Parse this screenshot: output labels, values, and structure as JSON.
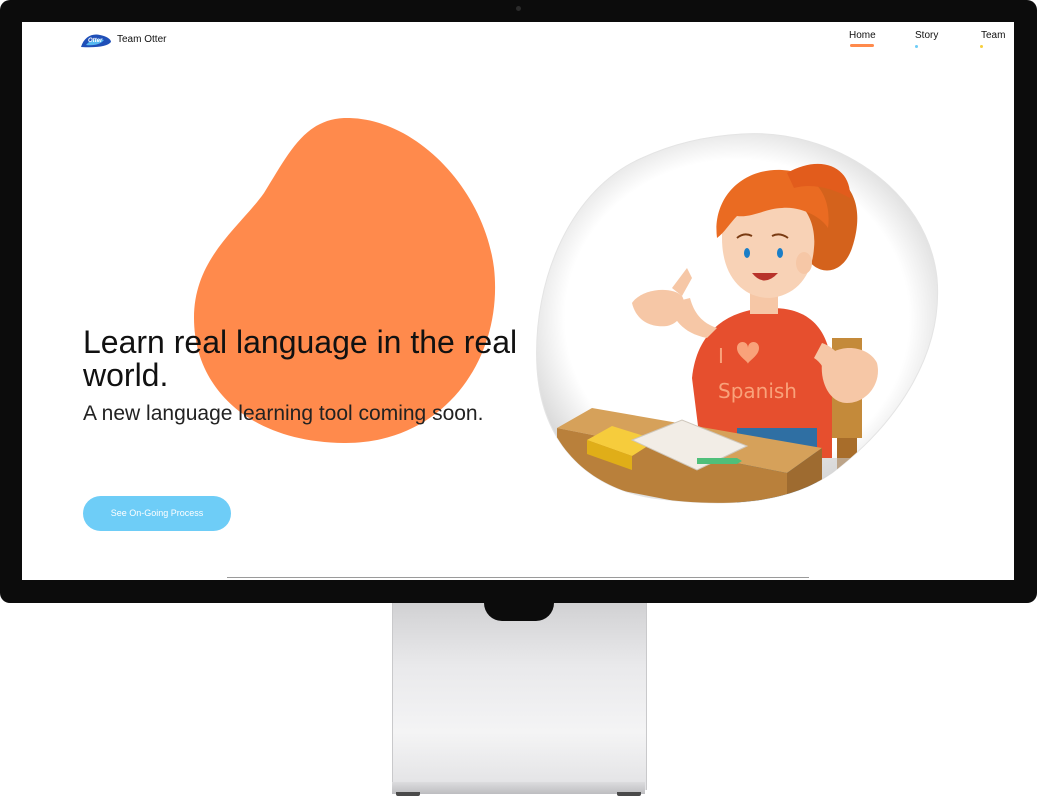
{
  "header": {
    "logo_text": "Otter",
    "brand": "Team Otter"
  },
  "nav": {
    "items": [
      {
        "label": "Home",
        "indicator_color": "#ff8a4c",
        "active": true
      },
      {
        "label": "Story",
        "indicator_color": "#6ecdf7",
        "active": false
      },
      {
        "label": "Team",
        "indicator_color": "#f7cf3c",
        "active": false
      }
    ]
  },
  "hero": {
    "headline": "Learn real language in the real world.",
    "subline": "A new language learning tool coming soon.",
    "cta_label": "See On-Going Process",
    "blob_color": "#ff8a4c"
  },
  "illustration": {
    "shirt_line1": "I",
    "shirt_line2": "Spanish"
  }
}
